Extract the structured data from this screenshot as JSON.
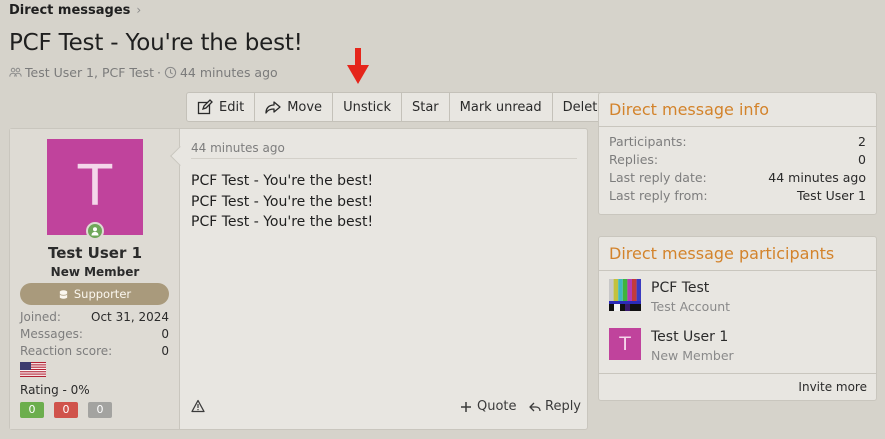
{
  "breadcrumb": {
    "label": "Direct messages",
    "chevron": "›"
  },
  "title": "PCF Test - You're the best!",
  "meta": {
    "participants": "Test User 1, PCF Test",
    "separator": "·",
    "time": "44 minutes ago"
  },
  "toolbar": {
    "edit": "Edit",
    "move": "Move",
    "unstick": "Unstick",
    "star": "Star",
    "mark_unread": "Mark unread",
    "delete": "Delete"
  },
  "post": {
    "author": {
      "avatar_letter": "T",
      "avatar_color": "#c0439c",
      "name": "Test User 1",
      "title": "New Member",
      "banner": "Supporter",
      "stats": [
        {
          "label": "Joined:",
          "value": "Oct 31, 2024"
        },
        {
          "label": "Messages:",
          "value": "0"
        },
        {
          "label": "Reaction score:",
          "value": "0"
        }
      ],
      "rating": "Rating - 0%",
      "votes": [
        "0",
        "0",
        "0"
      ]
    },
    "time": "44 minutes ago",
    "lines": [
      "PCF Test - You're the best!",
      "PCF Test - You're the best!",
      "PCF Test - You're the best!"
    ],
    "quote": "Quote",
    "reply": "Reply"
  },
  "info": {
    "title": "Direct message info",
    "rows": [
      {
        "label": "Participants:",
        "value": "2"
      },
      {
        "label": "Replies:",
        "value": "0"
      },
      {
        "label": "Last reply date:",
        "value": "44 minutes ago"
      },
      {
        "label": "Last reply from:",
        "value": "Test User 1"
      }
    ]
  },
  "participants": {
    "title": "Direct message participants",
    "items": [
      {
        "name": "PCF Test",
        "title": "Test Account"
      },
      {
        "name": "Test User 1",
        "title": "New Member",
        "letter": "T"
      }
    ],
    "invite": "Invite more"
  },
  "colors": {
    "accent": "#d3832b",
    "background": "#d6d3cb",
    "panel": "#e8e6e1",
    "arrow": "#e5251b"
  }
}
